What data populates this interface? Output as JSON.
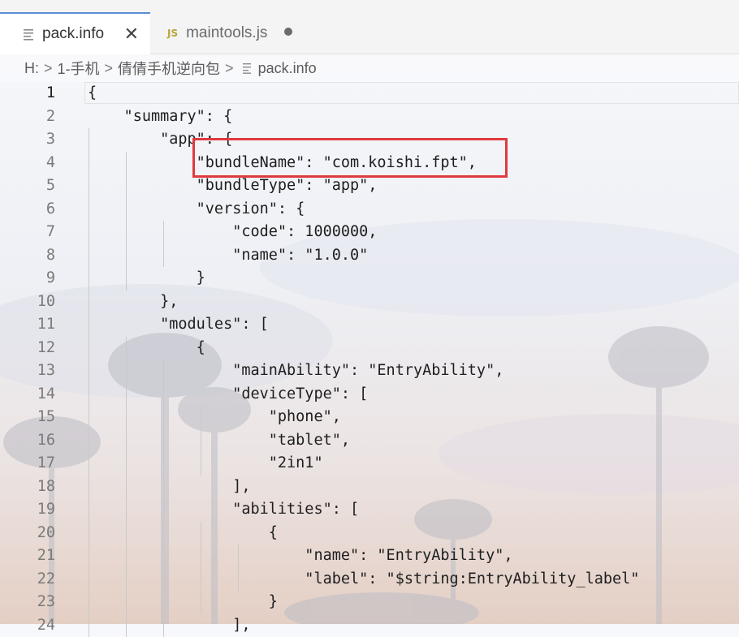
{
  "tabs": [
    {
      "label": "pack.info",
      "icon": "file-lines-icon",
      "active": true,
      "action_icon": "close-icon"
    },
    {
      "label": "maintools.js",
      "icon_text": "JS",
      "active": false,
      "action_icon": "unsaved-dot-icon"
    }
  ],
  "breadcrumb": {
    "items": [
      "H:",
      "1-手机",
      "倩倩手机逆向包",
      "pack.info"
    ],
    "separator": ">"
  },
  "editor": {
    "current_line": 1,
    "lines": [
      {
        "n": "1",
        "text": "{"
      },
      {
        "n": "2",
        "text": "    \"summary\": {"
      },
      {
        "n": "3",
        "text": "        \"app\": {"
      },
      {
        "n": "4",
        "text": "            \"bundleName\": \"com.koishi.fpt\","
      },
      {
        "n": "5",
        "text": "            \"bundleType\": \"app\","
      },
      {
        "n": "6",
        "text": "            \"version\": {"
      },
      {
        "n": "7",
        "text": "                \"code\": 1000000,"
      },
      {
        "n": "8",
        "text": "                \"name\": \"1.0.0\""
      },
      {
        "n": "9",
        "text": "            }"
      },
      {
        "n": "10",
        "text": "        },"
      },
      {
        "n": "11",
        "text": "        \"modules\": ["
      },
      {
        "n": "12",
        "text": "            {"
      },
      {
        "n": "13",
        "text": "                \"mainAbility\": \"EntryAbility\","
      },
      {
        "n": "14",
        "text": "                \"deviceType\": ["
      },
      {
        "n": "15",
        "text": "                    \"phone\","
      },
      {
        "n": "16",
        "text": "                    \"tablet\","
      },
      {
        "n": "17",
        "text": "                    \"2in1\""
      },
      {
        "n": "18",
        "text": "                ],"
      },
      {
        "n": "19",
        "text": "                \"abilities\": ["
      },
      {
        "n": "20",
        "text": "                    {"
      },
      {
        "n": "21",
        "text": "                        \"name\": \"EntryAbility\","
      },
      {
        "n": "22",
        "text": "                        \"label\": \"$string:EntryAbility_label\""
      },
      {
        "n": "23",
        "text": "                    }"
      },
      {
        "n": "24",
        "text": "                ],"
      }
    ]
  },
  "annotation": {
    "color": "#e03a3e",
    "target_line": 4
  },
  "colors": {
    "accent_tab": "#5b8fd3",
    "js_icon": "#b9a43a"
  }
}
